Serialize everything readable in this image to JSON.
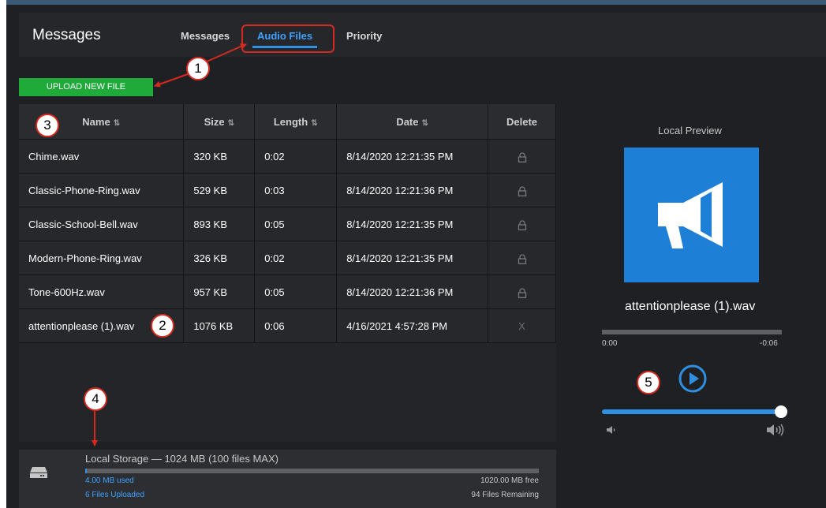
{
  "header": {
    "title": "Messages",
    "tabs": [
      {
        "label": "Messages"
      },
      {
        "label": "Audio Files",
        "active": true
      },
      {
        "label": "Priority"
      }
    ]
  },
  "upload_button": "UPLOAD NEW FILE",
  "table": {
    "columns": [
      "Name",
      "Size",
      "Length",
      "Date",
      "Delete"
    ],
    "sort_icon": "⇅",
    "rows": [
      {
        "name": "Chime.wav",
        "size": "320 KB",
        "length": "0:02",
        "date": "8/14/2020 12:21:35 PM",
        "delete": "lock-icon"
      },
      {
        "name": "Classic-Phone-Ring.wav",
        "size": "529 KB",
        "length": "0:03",
        "date": "8/14/2020 12:21:36 PM",
        "delete": "lock-icon"
      },
      {
        "name": "Classic-School-Bell.wav",
        "size": "893 KB",
        "length": "0:05",
        "date": "8/14/2020 12:21:35 PM",
        "delete": "lock-icon"
      },
      {
        "name": "Modern-Phone-Ring.wav",
        "size": "326 KB",
        "length": "0:02",
        "date": "8/14/2020 12:21:35 PM",
        "delete": "lock-icon"
      },
      {
        "name": "Tone-600Hz.wav",
        "size": "957 KB",
        "length": "0:05",
        "date": "8/14/2020 12:21:36 PM",
        "delete": "lock-icon"
      },
      {
        "name": "attentionplease (1).wav",
        "size": "1076 KB",
        "length": "0:06",
        "date": "4/16/2021 4:57:28 PM",
        "delete": "X"
      }
    ]
  },
  "storage": {
    "title": "Local Storage — 1024 MB (100 files MAX)",
    "used": "4.00 MB used",
    "free": "1020.00 MB free",
    "uploaded": "6 Files Uploaded",
    "remaining": "94 Files Remaining",
    "used_fraction": 0.004,
    "icon": "hard-drive-icon"
  },
  "preview": {
    "label": "Local Preview",
    "filename": "attentionplease (1).wav",
    "time_elapsed": "0:00",
    "time_remaining": "-0:06",
    "art_icon": "megaphone-icon",
    "volume_fraction": 1.0
  },
  "callouts": [
    "1",
    "2",
    "3",
    "4",
    "5"
  ],
  "colors": {
    "accent": "#2f8fe0",
    "upload_green": "#1faa3a",
    "annotation_red": "#d42a1f",
    "background": "#1f2023"
  }
}
